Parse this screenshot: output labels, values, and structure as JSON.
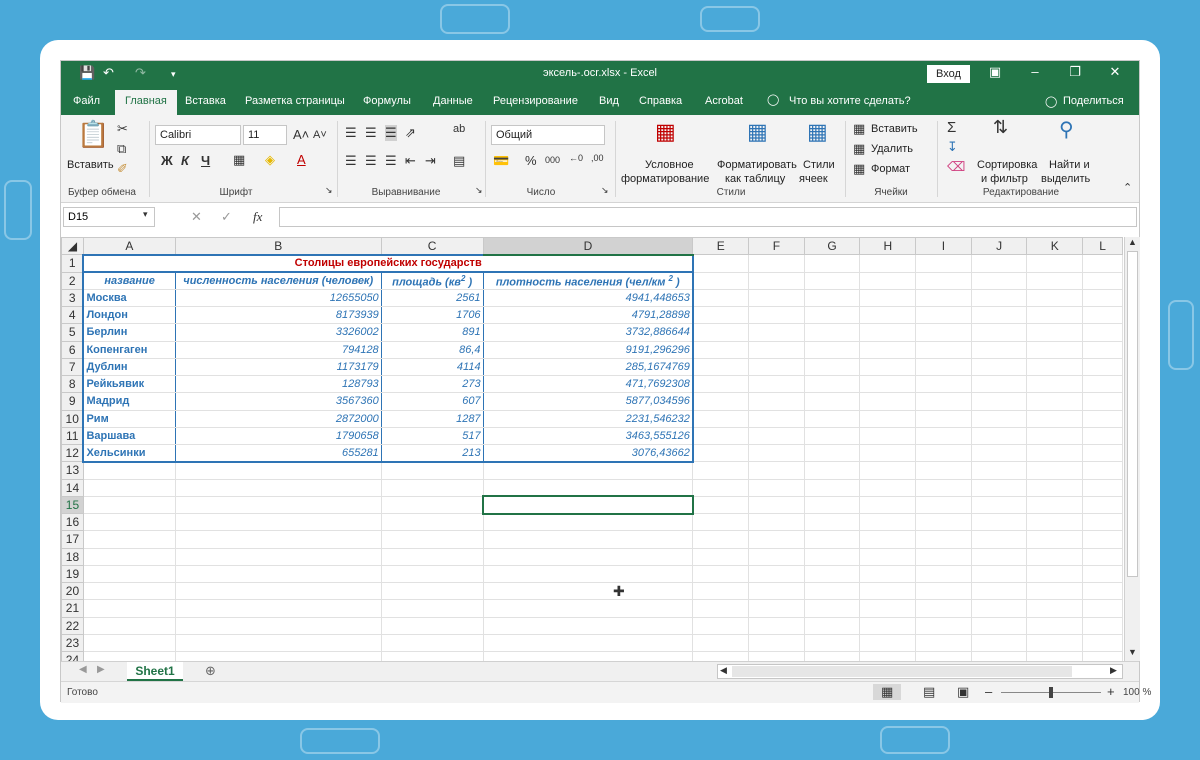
{
  "title_bar": {
    "doc_title": "эксель-.ocr.xlsx  -  Excel",
    "signin_label": "Вход"
  },
  "tabs": [
    {
      "label": "Файл"
    },
    {
      "label": "Главная"
    },
    {
      "label": "Вставка"
    },
    {
      "label": "Разметка страницы"
    },
    {
      "label": "Формулы"
    },
    {
      "label": "Данные"
    },
    {
      "label": "Рецензирование"
    },
    {
      "label": "Вид"
    },
    {
      "label": "Справка"
    },
    {
      "label": "Acrobat"
    },
    {
      "label": "Что вы хотите сделать?"
    },
    {
      "label": "Поделиться"
    }
  ],
  "ribbon": {
    "paste_label": "Вставить",
    "clipboard_group": "Буфер обмена",
    "font_name": "Calibri",
    "font_size": "11",
    "bold": "Ж",
    "italic": "К",
    "underline": "Ч",
    "font_group": "Шрифт",
    "alignment_group": "Выравнивание",
    "number_format": "Общий",
    "number_group": "Число",
    "cond_format_1": "Условное",
    "cond_format_2": "форматирование",
    "format_table_1": "Форматировать",
    "format_table_2": "как таблицу",
    "cell_styles_1": "Стили",
    "cell_styles_2": "ячеек",
    "styles_group": "Стили",
    "insert_cells": "Вставить",
    "delete_cells": "Удалить",
    "format_cells": "Формат",
    "cells_group": "Ячейки",
    "sort_1": "Сортировка",
    "sort_2": "и фильтр",
    "find_1": "Найти и",
    "find_2": "выделить",
    "editing_group": "Редактирование"
  },
  "formula_bar": {
    "name_box": "D15",
    "fx": "fx",
    "value": ""
  },
  "columns": [
    "A",
    "B",
    "C",
    "D",
    "E",
    "F",
    "G",
    "H",
    "I",
    "J",
    "K",
    "L"
  ],
  "table": {
    "title": "Столицы европейских государств",
    "headers": [
      "название",
      "численность населения (человек)",
      "площадь (кв",
      "плотность населения (чел/км"
    ],
    "header_sup": "2",
    "header_close": ")",
    "rows": [
      [
        "Москва",
        "12655050",
        "2561",
        "4941,448653"
      ],
      [
        "Лондон",
        "8173939",
        "1706",
        "4791,28898"
      ],
      [
        "Берлин",
        "3326002",
        "891",
        "3732,886644"
      ],
      [
        "Копенгаген",
        "794128",
        "86,4",
        "9191,296296"
      ],
      [
        "Дублин",
        "1173179",
        "4114",
        "285,1674769"
      ],
      [
        "Рейкьявик",
        "128793",
        "273",
        "471,7692308"
      ],
      [
        "Мадрид",
        "3567360",
        "607",
        "5877,034596"
      ],
      [
        "Рим",
        "2872000",
        "1287",
        "2231,546232"
      ],
      [
        "Варшава",
        "1790658",
        "517",
        "3463,555126"
      ],
      [
        "Хельсинки",
        "655281",
        "213",
        "3076,43662"
      ]
    ]
  },
  "row_numbers": [
    "1",
    "2",
    "3",
    "4",
    "5",
    "6",
    "7",
    "8",
    "9",
    "10",
    "11",
    "12",
    "13",
    "14",
    "15",
    "16",
    "17",
    "18",
    "19",
    "20",
    "21",
    "22",
    "23",
    "24"
  ],
  "sheet_tab": "Sheet1",
  "status": {
    "ready": "Готово",
    "zoom": "100 %"
  },
  "colors": {
    "excel_green": "#217346",
    "table_blue": "#2e74b5",
    "title_red": "#c00000",
    "background": "#4aa9d9"
  }
}
